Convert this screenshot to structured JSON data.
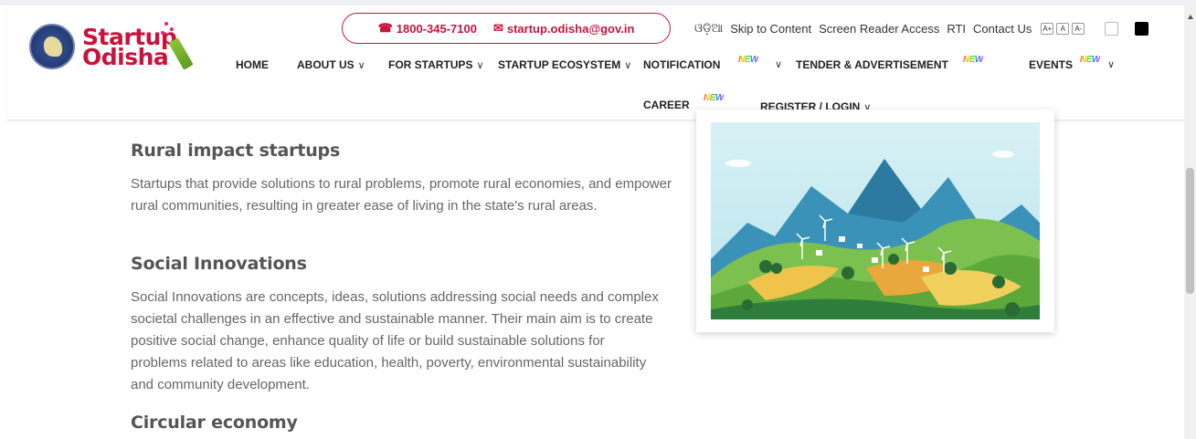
{
  "header": {
    "logo": {
      "line1": "Startup",
      "line2": "Odisha"
    },
    "contact": {
      "phone": "1800-345-7100",
      "email": "startup.odisha@gov.in"
    },
    "utility": {
      "language": "ଓଡ଼ିଆ",
      "skip": "Skip to Content",
      "screen_reader": "Screen Reader Access",
      "rti": "RTI",
      "contact_us": "Contact Us",
      "font_larger": "A+",
      "font_normal": "A",
      "font_smaller": "A-"
    },
    "nav": {
      "home": "HOME",
      "about": "ABOUT US",
      "for_startups": "FOR STARTUPS",
      "ecosystem": "STARTUP ECOSYSTEM",
      "notification": "NOTIFICATION",
      "tender": "TENDER & ADVERTISEMENT",
      "events": "EVENTS",
      "career": "CAREER",
      "register": "REGISTER / LOGIN",
      "new_label": "NEW"
    },
    "colors": {
      "brand": "#c8143c"
    }
  },
  "main": {
    "sections": [
      {
        "title": "Rural impact startups",
        "text": "Startups that provide solutions to rural problems, promote rural economies, and empower rural communities, resulting in greater ease of living in the state's rural areas."
      },
      {
        "title": "Social Innovations",
        "text": "Social Innovations are concepts, ideas, solutions addressing social needs and complex societal challenges in an effective and sustainable manner. Their main aim is to create positive social change, enhance quality of life or build sustainable solutions for problems related to areas like education, health, poverty, environmental sustainability and community development."
      },
      {
        "title": "Circular economy",
        "text": ""
      }
    ]
  }
}
